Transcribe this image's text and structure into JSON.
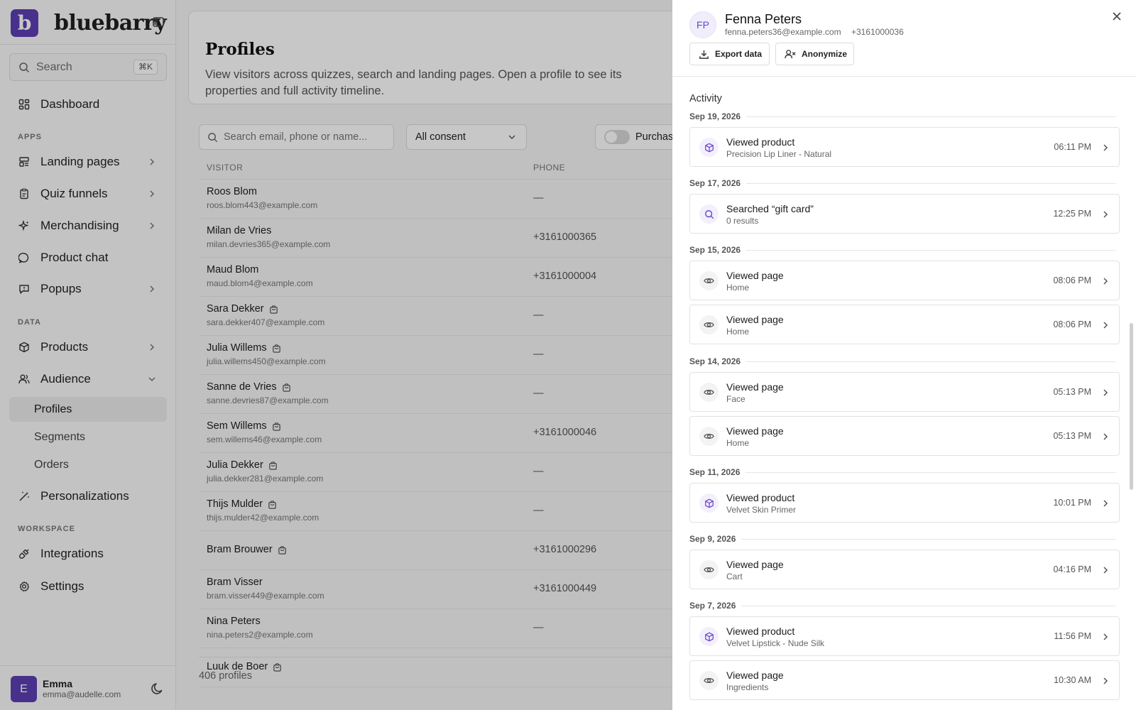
{
  "brand": {
    "logo_letter": "b",
    "name": "bluebarry",
    "accent": "#5b3fb3"
  },
  "sidebar": {
    "search_label": "Search",
    "search_shortcut": "⌘K",
    "dashboard": "Dashboard",
    "section_apps": "APPS",
    "apps": [
      "Landing pages",
      "Quiz funnels",
      "Merchandising",
      "Product chat",
      "Popups"
    ],
    "section_data": "DATA",
    "products": "Products",
    "audience": "Audience",
    "audience_sub": [
      "Profiles",
      "Segments",
      "Orders"
    ],
    "personalizations": "Personalizations",
    "section_workspace": "WORKSPACE",
    "integrations": "Integrations",
    "settings": "Settings",
    "user": {
      "initial": "E",
      "name": "Emma",
      "email": "emma@audelle.com"
    }
  },
  "main": {
    "title": "Profiles",
    "description": "View visitors across quizzes, search and landing pages. Open a profile to see its properties and full activity timeline.",
    "search_placeholder": "Search email, phone or name...",
    "consent_filter": "All consent",
    "purchased_toggle": "Purchas",
    "columns": {
      "visitor": "VISITOR",
      "phone": "PHONE"
    },
    "rows": [
      {
        "name": "Roos Blom",
        "email": "roos.blom443@example.com",
        "phone": "—"
      },
      {
        "name": "Milan de Vries",
        "email": "milan.devries365@example.com",
        "phone": "+3161000365"
      },
      {
        "name": "Maud Blom",
        "email": "maud.blom4@example.com",
        "phone": "+3161000004"
      },
      {
        "name": "Sara Dekker",
        "email": "sara.dekker407@example.com",
        "phone": "—"
      },
      {
        "name": "Julia Willems",
        "email": "julia.willems450@example.com",
        "phone": "—"
      },
      {
        "name": "Sanne de Vries",
        "email": "sanne.devries87@example.com",
        "phone": "—"
      },
      {
        "name": "Sem Willems",
        "email": "sem.willems46@example.com",
        "phone": "+3161000046"
      },
      {
        "name": "Julia Dekker",
        "email": "julia.dekker281@example.com",
        "phone": "—"
      },
      {
        "name": "Thijs Mulder",
        "email": "thijs.mulder42@example.com",
        "phone": "—"
      },
      {
        "name": "Bram Brouwer",
        "email": "",
        "phone": "+3161000296"
      },
      {
        "name": "Bram Visser",
        "email": "bram.visser449@example.com",
        "phone": "+3161000449"
      },
      {
        "name": "Nina Peters",
        "email": "nina.peters2@example.com",
        "phone": "—"
      },
      {
        "name": "Luuk de Boer",
        "email": "",
        "phone": ""
      }
    ],
    "count": "406 profiles"
  },
  "drawer": {
    "initials": "FP",
    "name": "Fenna Peters",
    "email": "fenna.peters36@example.com",
    "phone": "+3161000036",
    "export_label": "Export data",
    "anonymize_label": "Anonymize",
    "activity_title": "Activity",
    "dates": [
      "Sep 19, 2026",
      "Sep 17, 2026",
      "Sep 15, 2026",
      "Sep 14, 2026",
      "Sep 11, 2026",
      "Sep 9, 2026",
      "Sep 7, 2026"
    ],
    "events": [
      {
        "title": "Viewed product",
        "sub": "Precision Lip Liner - Natural",
        "time": "06:11 PM",
        "icon": "package-icon"
      },
      {
        "title": "Searched “gift card”",
        "sub": "0 results",
        "time": "12:25 PM",
        "icon": "search-icon"
      },
      {
        "title": "Viewed page",
        "sub": "Home",
        "time": "08:06 PM",
        "icon": "eye-icon"
      },
      {
        "title": "Viewed page",
        "sub": "Home",
        "time": "08:06 PM",
        "icon": "eye-icon"
      },
      {
        "title": "Viewed page",
        "sub": "Face",
        "time": "05:13 PM",
        "icon": "eye-icon"
      },
      {
        "title": "Viewed page",
        "sub": "Home",
        "time": "05:13 PM",
        "icon": "eye-icon"
      },
      {
        "title": "Viewed product",
        "sub": "Velvet Skin Primer",
        "time": "10:01 PM",
        "icon": "package-icon"
      },
      {
        "title": "Viewed page",
        "sub": "Cart",
        "time": "04:16 PM",
        "icon": "eye-icon"
      },
      {
        "title": "Viewed product",
        "sub": "Velvet Lipstick - Nude Silk",
        "time": "11:56 PM",
        "icon": "package-icon"
      },
      {
        "title": "Viewed page",
        "sub": "Ingredients",
        "time": "10:30 AM",
        "icon": "eye-icon"
      }
    ]
  }
}
